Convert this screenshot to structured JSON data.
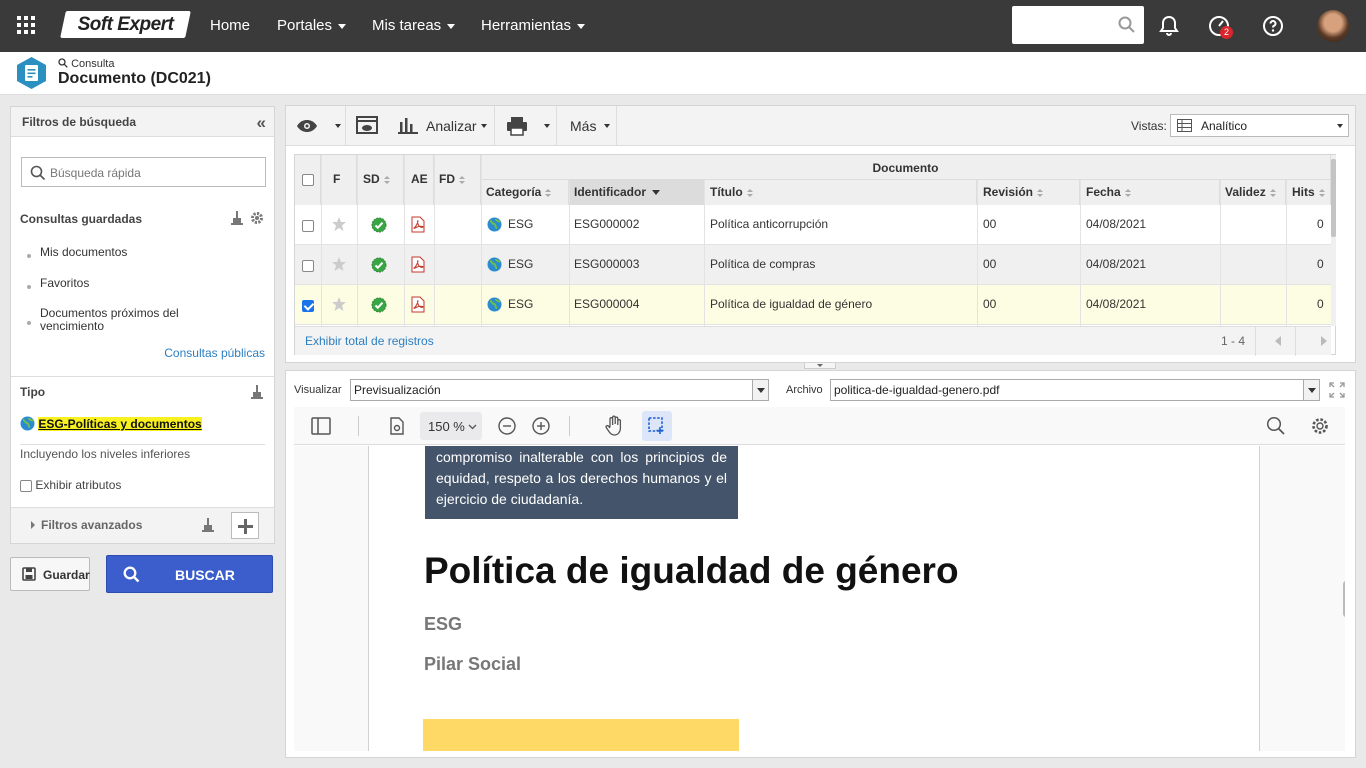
{
  "topbar": {
    "logo": "Soft Expert",
    "nav": [
      {
        "label": "Home",
        "dropdown": false
      },
      {
        "label": "Portales",
        "dropdown": true
      },
      {
        "label": "Mis tareas",
        "dropdown": true
      },
      {
        "label": "Herramientas",
        "dropdown": true
      }
    ],
    "search_placeholder": "",
    "tasks_badge": "2"
  },
  "header": {
    "breadcrumb": "Consulta",
    "title": "Documento (DC021)"
  },
  "sidebar": {
    "title": "Filtros de búsqueda",
    "quick_search_placeholder": "Búsqueda rápida",
    "saved_title": "Consultas guardadas",
    "saved_items": [
      "Mis documentos",
      "Favoritos",
      "Documentos próximos del vencimiento"
    ],
    "public_link": "Consultas públicas",
    "type_title": "Tipo",
    "type_value": "ESG-Políticas y documentos",
    "including_text": "Incluyendo los niveles inferiores",
    "show_attributes": "Exhibir atributos",
    "advanced_filters": "Filtros avanzados"
  },
  "actions": {
    "save_label": "Guardar",
    "search_label": "BUSCAR"
  },
  "toolbar": {
    "analyze_label": "Analizar",
    "more_label": "Más",
    "views_label": "Vistas:",
    "views_value": "Analítico"
  },
  "table": {
    "group_header": "Documento",
    "columns": {
      "f": "F",
      "sd": "SD",
      "ae": "AE",
      "fd": "FD",
      "category": "Categoría",
      "identifier": "Identificador",
      "title": "Título",
      "revision": "Revisión",
      "date": "Fecha",
      "validity": "Validez",
      "hits": "Hits"
    },
    "rows": [
      {
        "category": "ESG",
        "identifier": "ESG000002",
        "title": "Política anticorrupción",
        "revision": "00",
        "date": "04/08/2021",
        "validity": "",
        "hits": "0",
        "checked": false
      },
      {
        "category": "ESG",
        "identifier": "ESG000003",
        "title": "Política de compras",
        "revision": "00",
        "date": "04/08/2021",
        "validity": "",
        "hits": "0",
        "checked": false
      },
      {
        "category": "ESG",
        "identifier": "ESG000004",
        "title": "Política de igualdad de género",
        "revision": "00",
        "date": "04/08/2021",
        "validity": "",
        "hits": "0",
        "checked": true
      }
    ],
    "footer_link": "Exhibir total de registros",
    "range": "1 - 4"
  },
  "viewer": {
    "visualize_label": "Visualizar",
    "visualize_value": "Previsualización",
    "file_label": "Archivo",
    "file_value": "politica-de-igualdad-genero.pdf",
    "zoom": "150 %",
    "pdf": {
      "box_text": "compromiso inalterable con los principios de equidad, respeto a los derechos humanos y el ejercicio de ciudadanía.",
      "heading": "Política de igualdad de género",
      "sub1": "ESG",
      "sub2": "Pilar Social"
    }
  },
  "colors": {
    "topbar": "#3a3a3a",
    "accent": "#3b5ecc",
    "highlight": "#f8f01f",
    "selected_row": "#fdfde3",
    "pdf_box": "#44546a",
    "pdf_yellow": "#ffd966"
  }
}
